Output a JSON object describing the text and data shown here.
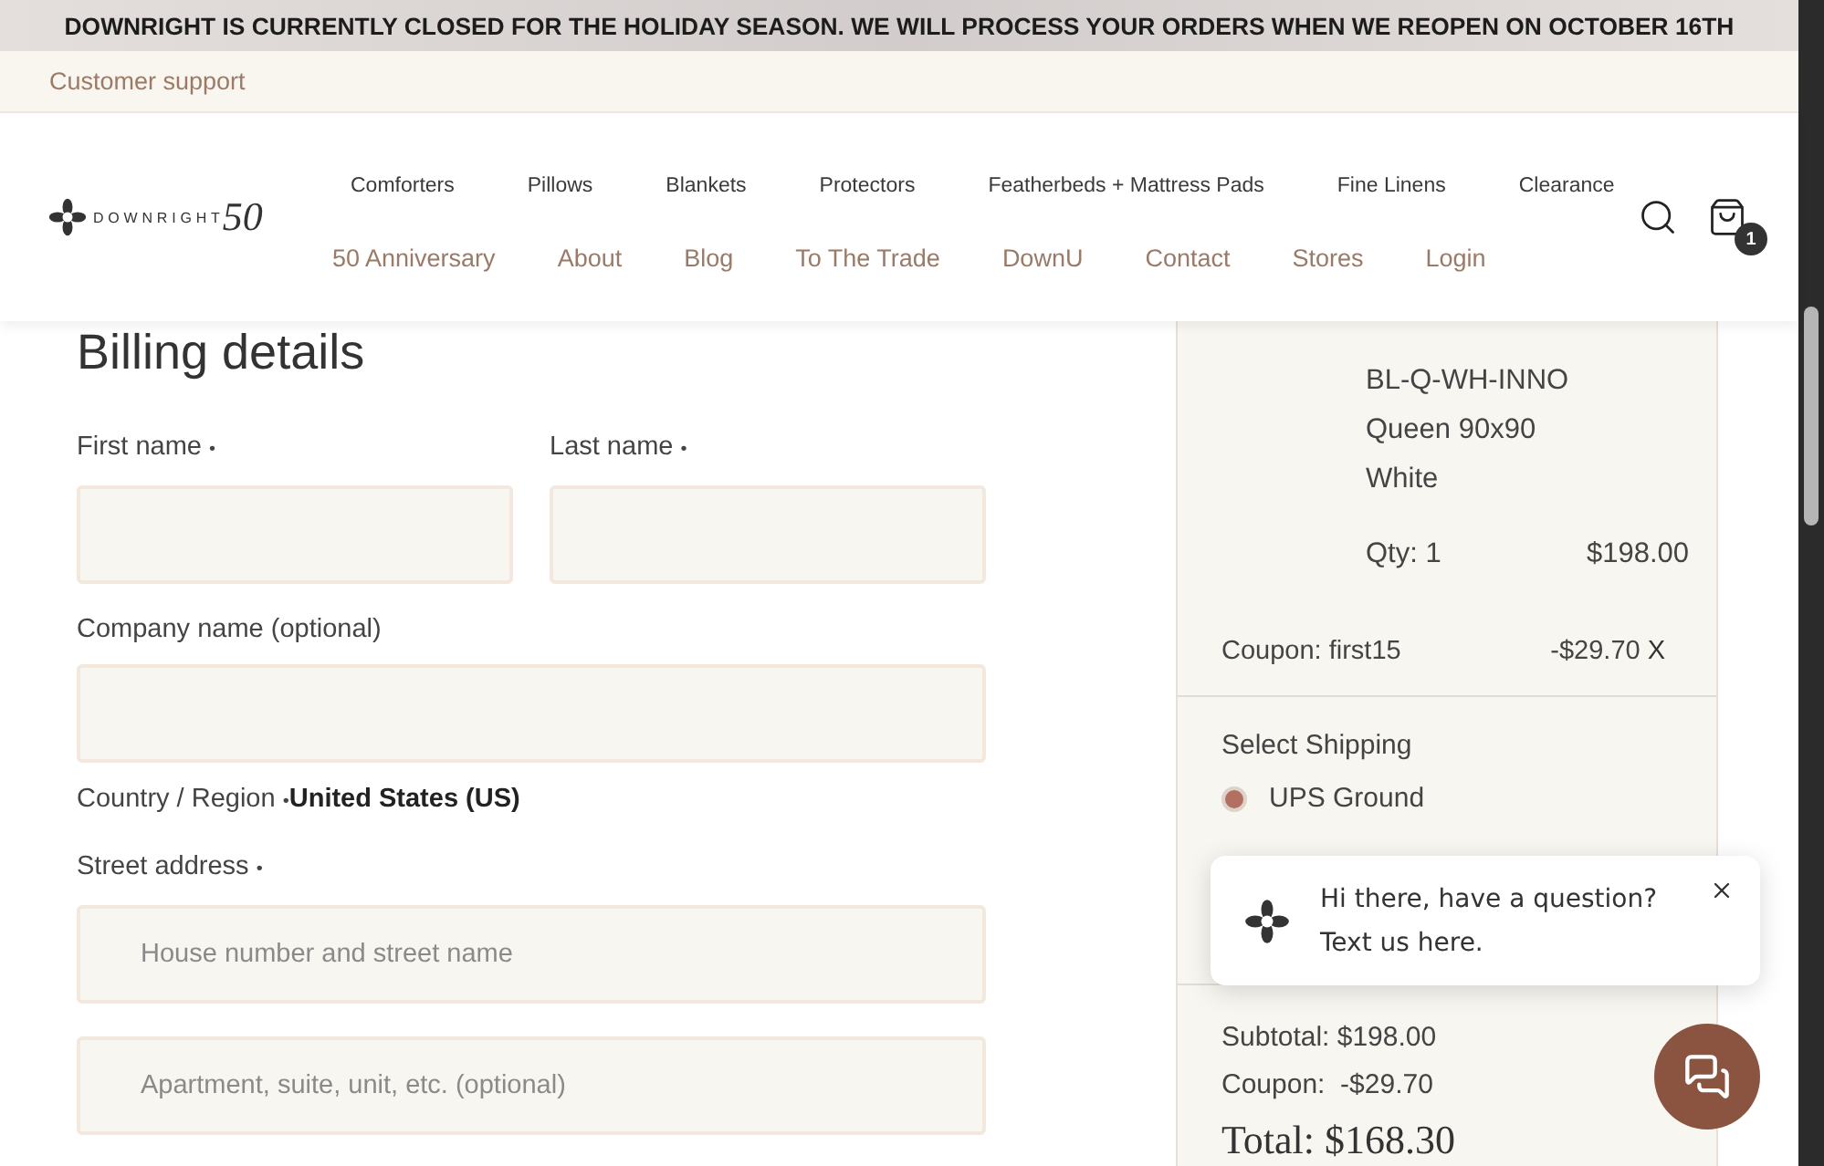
{
  "announcement": "DOWNRIGHT IS CURRENTLY CLOSED FOR THE HOLIDAY SEASON. WE WILL PROCESS YOUR ORDERS WHEN WE REOPEN ON OCTOBER 16TH",
  "support_link": "Customer support",
  "logo": {
    "name": "DOWNRIGHT",
    "mark": "50"
  },
  "nav_primary": [
    "Comforters",
    "Pillows",
    "Blankets",
    "Protectors",
    "Featherbeds + Mattress Pads",
    "Fine Linens",
    "Clearance"
  ],
  "nav_secondary": [
    "50 Anniversary",
    "About",
    "Blog",
    "To The Trade",
    "DownU",
    "Contact",
    "Stores",
    "Login"
  ],
  "cart_count": "1",
  "billing": {
    "title": "Billing details",
    "name_fields": [
      {
        "label": "First name",
        "required_mark": "•"
      },
      {
        "label": "Last name",
        "required_mark": "•"
      }
    ],
    "company": {
      "label": "Company name (optional)"
    },
    "country": {
      "label": "Country / Region",
      "required_mark": "•",
      "value": "United States (US)"
    },
    "street": {
      "label": "Street address",
      "required_mark": "•",
      "placeholders": [
        "House number and street name",
        "Apartment, suite, unit, etc. (optional)"
      ]
    }
  },
  "summary": {
    "item": {
      "sku": "BL-Q-WH-INNO",
      "size": "Queen 90x90",
      "variant": "White",
      "qty": "Qty: 1",
      "price": "$198.00"
    },
    "coupon": {
      "label": "Coupon: first15",
      "amount": "-$29.70",
      "remove": "X"
    },
    "shipping": {
      "title": "Select Shipping",
      "options": [
        {
          "label": "UPS Ground",
          "selected": true
        }
      ]
    },
    "subtotal": "Subtotal: $198.00",
    "coupon_total": "Coupon:  -$29.70",
    "total": "Total: $168.30"
  },
  "chat": {
    "lines": [
      "Hi there, have a question?",
      "Text us here."
    ]
  }
}
